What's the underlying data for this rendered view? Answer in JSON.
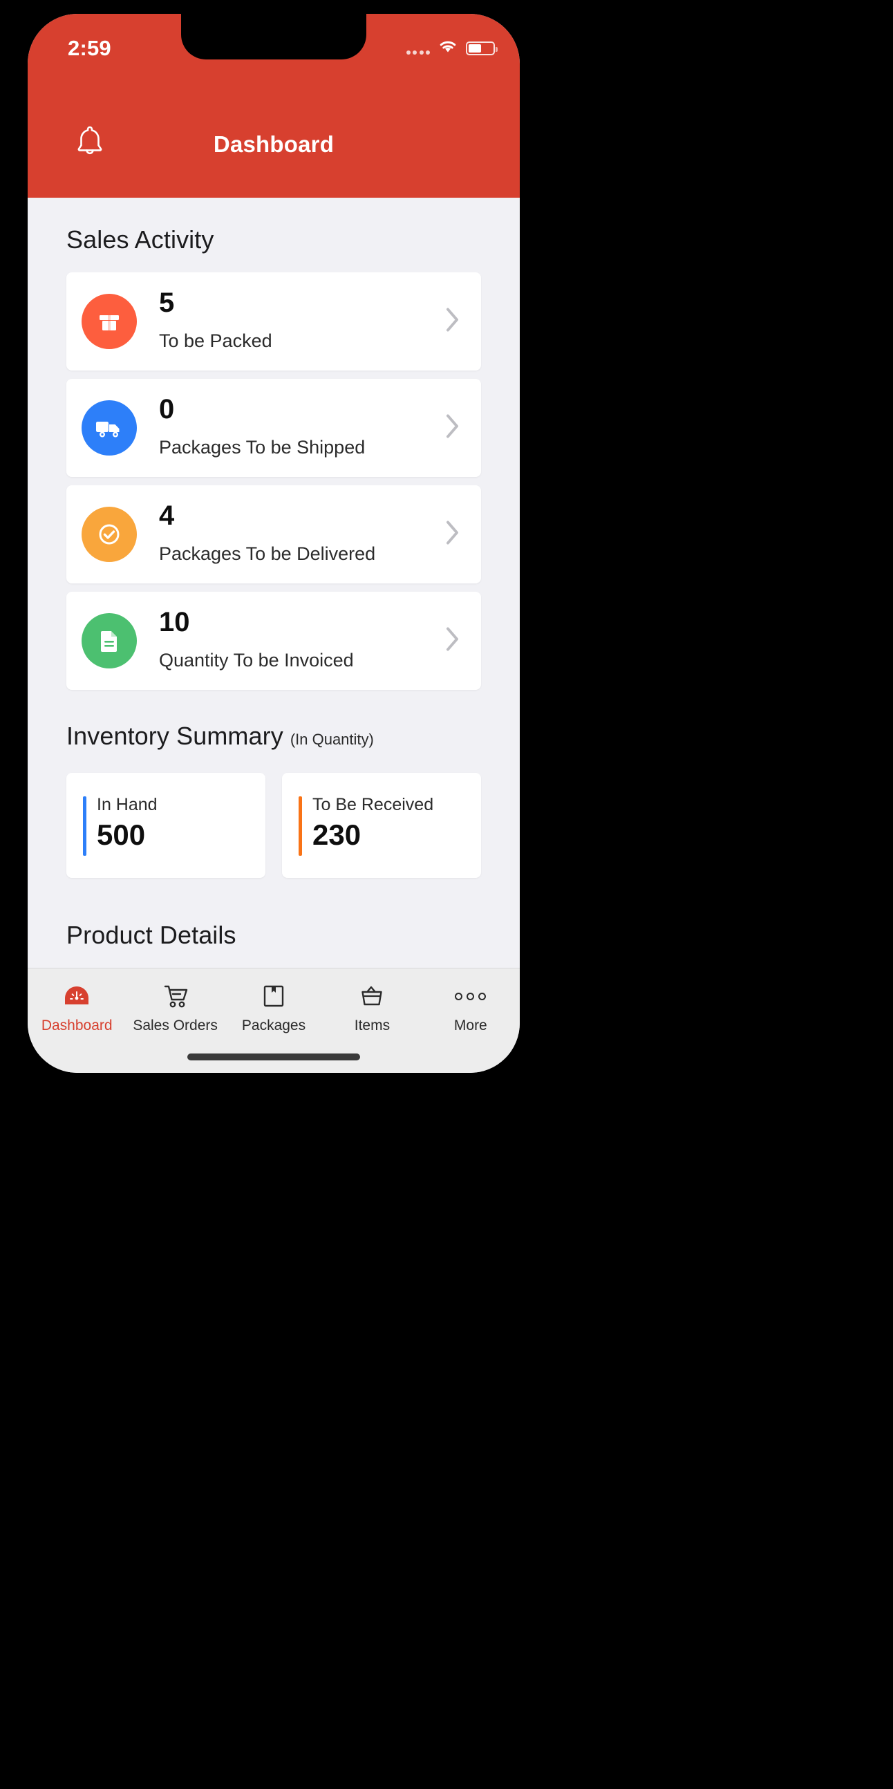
{
  "status_bar": {
    "time": "2:59",
    "signal_icon": "signal-dots-icon",
    "wifi_icon": "wifi-icon",
    "battery_icon": "battery-icon"
  },
  "nav_bar": {
    "title": "Dashboard",
    "bell_icon": "bell-icon"
  },
  "colors": {
    "brand_red": "#D7402F",
    "packed_orange": "#FD5E3E",
    "shipped_blue": "#2D7FF9",
    "delivered_amber": "#F9A63C",
    "invoiced_green": "#4CC070",
    "inhand_bar": "#2D7FF9",
    "received_bar": "#F97316",
    "page_bg": "#F1F1F5"
  },
  "sales_activity": {
    "heading": "Sales Activity",
    "items": [
      {
        "count": "5",
        "label": "To be Packed",
        "icon": "package-box-icon",
        "color": "#FD5E3E"
      },
      {
        "count": "0",
        "label": "Packages To be Shipped",
        "icon": "delivery-truck-icon",
        "color": "#2D7FF9"
      },
      {
        "count": "4",
        "label": "Packages To be Delivered",
        "icon": "check-circle-icon",
        "color": "#F9A63C"
      },
      {
        "count": "10",
        "label": "Quantity To be Invoiced",
        "icon": "invoice-document-icon",
        "color": "#4CC070"
      }
    ],
    "chevron_icon": "chevron-right-icon"
  },
  "inventory_summary": {
    "heading": "Inventory Summary",
    "subheading": "(In Quantity)",
    "cards": [
      {
        "label": "In Hand",
        "value": "500",
        "accent": "#2D7FF9"
      },
      {
        "label": "To Be Received",
        "value": "230",
        "accent": "#F97316"
      }
    ]
  },
  "product_details": {
    "heading": "Product Details"
  },
  "tab_bar": {
    "items": [
      {
        "label": "Dashboard",
        "icon": "speedometer-icon",
        "active": true
      },
      {
        "label": "Sales Orders",
        "icon": "shopping-cart-icon",
        "active": false
      },
      {
        "label": "Packages",
        "icon": "package-box-icon",
        "active": false
      },
      {
        "label": "Items",
        "icon": "basket-icon",
        "active": false
      },
      {
        "label": "More",
        "icon": "more-dots-icon",
        "active": false
      }
    ]
  }
}
